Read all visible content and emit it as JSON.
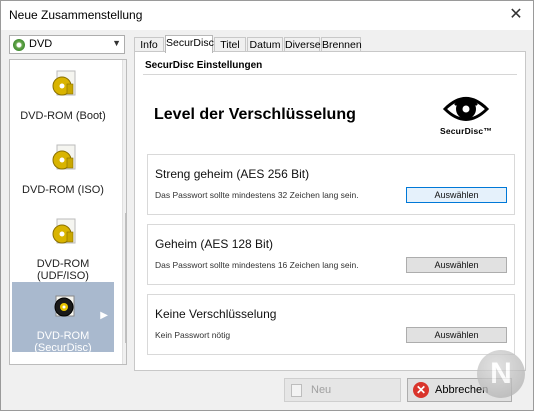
{
  "window": {
    "title": "Neue Zusammenstellung"
  },
  "disc_select": {
    "value": "DVD"
  },
  "project_types": [
    {
      "label": "DVD-ROM (Boot)"
    },
    {
      "label": "DVD-ROM (ISO)"
    },
    {
      "label": "DVD-ROM (UDF/ISO)"
    },
    {
      "label": "DVD-ROM (SecurDisc)",
      "selected": true
    }
  ],
  "tabs": [
    {
      "label": "Info"
    },
    {
      "label": "SecurDisc",
      "active": true
    },
    {
      "label": "Titel"
    },
    {
      "label": "Datum"
    },
    {
      "label": "Diverse"
    },
    {
      "label": "Brennen"
    }
  ],
  "panel": {
    "header": "SecurDisc Einstellungen",
    "heading": "Level der Verschlüsselung",
    "logo_text": "SecurDisc™"
  },
  "options": [
    {
      "title": "Streng geheim (AES 256 Bit)",
      "desc": "Das Passwort sollte mindestens 32 Zeichen lang sein.",
      "button": "Auswählen",
      "focused": true
    },
    {
      "title": "Geheim (AES 128 Bit)",
      "desc": "Das Passwort sollte mindestens 16 Zeichen lang sein.",
      "button": "Auswählen"
    },
    {
      "title": "Keine Verschlüsselung",
      "desc": "Kein Passwort nötig",
      "button": "Auswählen"
    }
  ],
  "footer": {
    "new_label": "Neu",
    "cancel_label": "Abbrechen"
  },
  "colors": {
    "selection": "#a9b9ce",
    "focus_border": "#0078d7",
    "cancel_icon": "#d9342b"
  }
}
